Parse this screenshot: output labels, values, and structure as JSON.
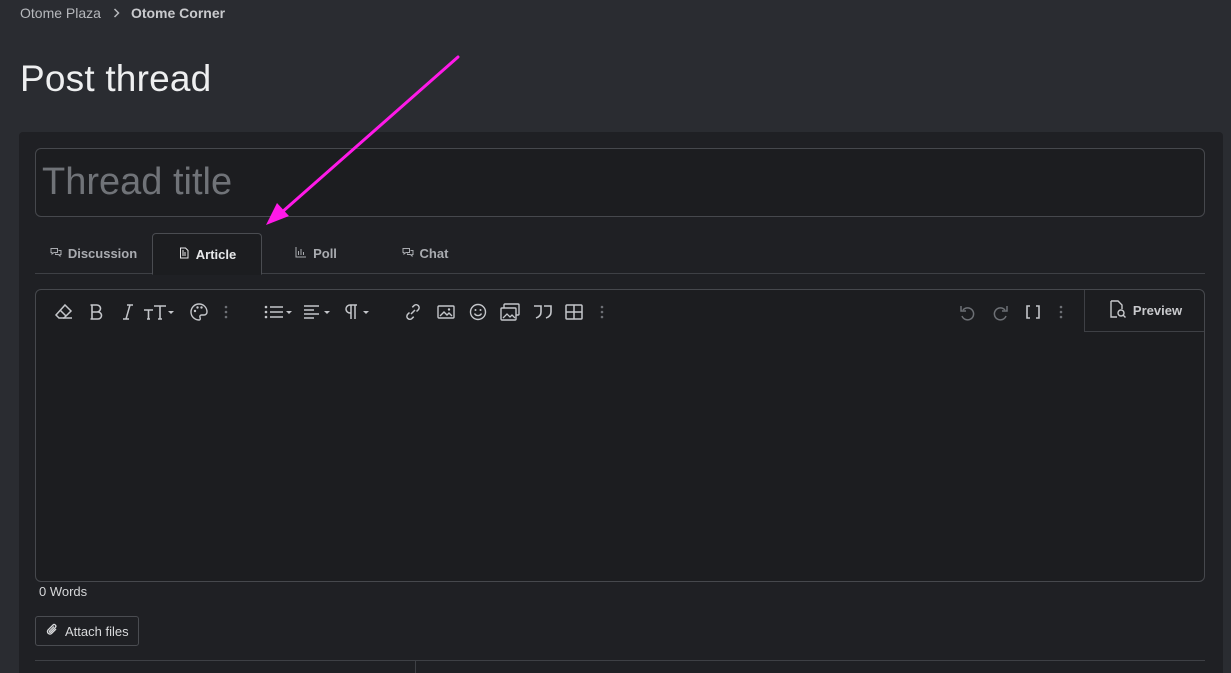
{
  "breadcrumb": {
    "items": [
      "Otome Plaza",
      "Otome Corner"
    ]
  },
  "page": {
    "title": "Post thread"
  },
  "thread_title": {
    "placeholder": "Thread title",
    "value": ""
  },
  "tabs": [
    {
      "label": "Discussion",
      "icon": "discussion-icon",
      "active": false
    },
    {
      "label": "Article",
      "icon": "article-icon",
      "active": true
    },
    {
      "label": "Poll",
      "icon": "poll-icon",
      "active": false
    },
    {
      "label": "Chat",
      "icon": "chat-icon",
      "active": false
    }
  ],
  "editor": {
    "toolbar_icons": [
      "eraser-icon",
      "bold-icon",
      "italic-icon",
      "text-size-icon",
      "palette-icon",
      "more-icon",
      "list-icon",
      "align-icon",
      "paragraph-icon",
      "link-icon",
      "image-icon",
      "smiley-icon",
      "media-icon",
      "quote-icon",
      "table-icon",
      "more-icon",
      "undo-icon",
      "redo-icon",
      "bbcode-icon",
      "more-icon"
    ],
    "preview_label": "Preview",
    "content": ""
  },
  "word_count": "0 Words",
  "attach": {
    "label": "Attach files"
  },
  "colors": {
    "annotation_arrow": "#ff19e8",
    "background": "#2a2c31",
    "panel": "#1f2024"
  }
}
